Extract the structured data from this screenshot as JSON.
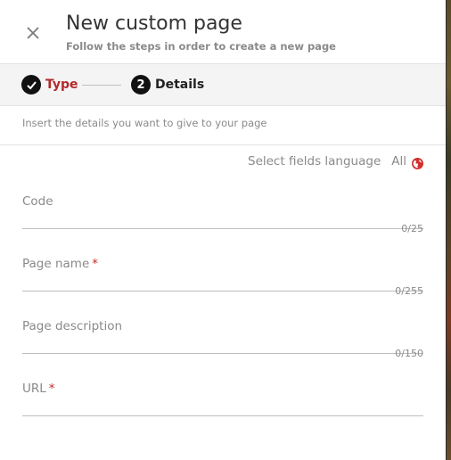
{
  "header": {
    "title": "New custom page",
    "subtitle": "Follow the steps in order to create a new page"
  },
  "stepper": {
    "steps": [
      {
        "number": "1",
        "label": "Type",
        "state": "completed"
      },
      {
        "number": "2",
        "label": "Details",
        "state": "active"
      }
    ]
  },
  "instructions": "Insert the details you want to give to your page",
  "language": {
    "label": "Select fields language",
    "value": "All",
    "icon": "globe-icon"
  },
  "fields": [
    {
      "label": "Code",
      "required": false,
      "value": "",
      "counter": "0/25"
    },
    {
      "label": "Page name",
      "required": true,
      "value": "",
      "counter": "0/255"
    },
    {
      "label": "Page description",
      "required": false,
      "value": "",
      "counter": "0/150"
    },
    {
      "label": "URL",
      "required": true,
      "value": ""
    }
  ],
  "required_marker": "*",
  "colors": {
    "accent": "#b22a2a",
    "required": "#c62828",
    "globe": "#d32f2f"
  }
}
